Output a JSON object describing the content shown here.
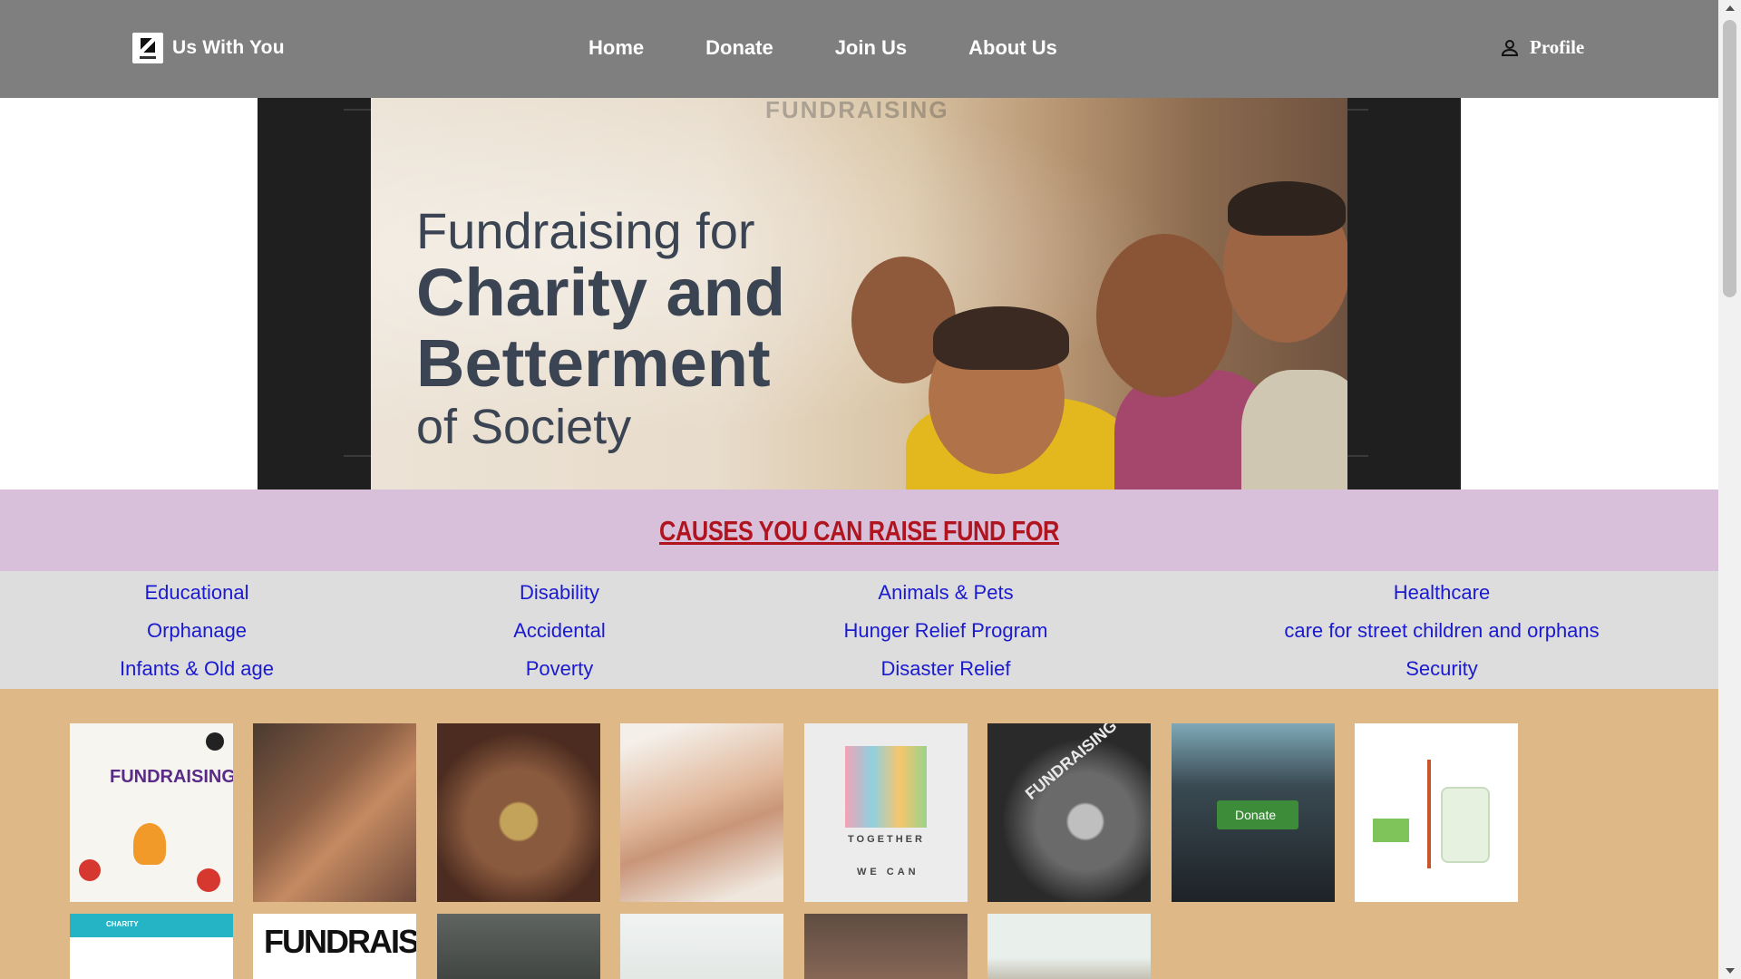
{
  "nav": {
    "brand": "Us With You",
    "links": [
      "Home",
      "Donate",
      "Join Us",
      "About Us"
    ],
    "profile": "Profile"
  },
  "hero": {
    "watermark": "FUNDRAISING",
    "line1": "Fundraising for",
    "line2": "Charity and",
    "line3": "Betterment",
    "line4": "of Society"
  },
  "causes": {
    "title": "CAUSES YOU CAN RAISE FUND FOR",
    "items": [
      "Educational",
      "Disability",
      "Animals & Pets",
      "Healthcare",
      "Orphanage",
      "Accidental",
      "Hunger Relief Program",
      "care for street children and orphans",
      "Infants & Old age",
      "Poverty",
      "Disaster Relief",
      "Security"
    ]
  },
  "gallery": {
    "fundraising_label": "FUNDRAISING",
    "together_label": "TOGETHER",
    "wecan_label": "WE CAN",
    "gears_label": "FUNDRAISING",
    "donate_key_label": "Donate",
    "charity_label": "CHARITY",
    "fundraising_big": "FUNDRAISING"
  }
}
